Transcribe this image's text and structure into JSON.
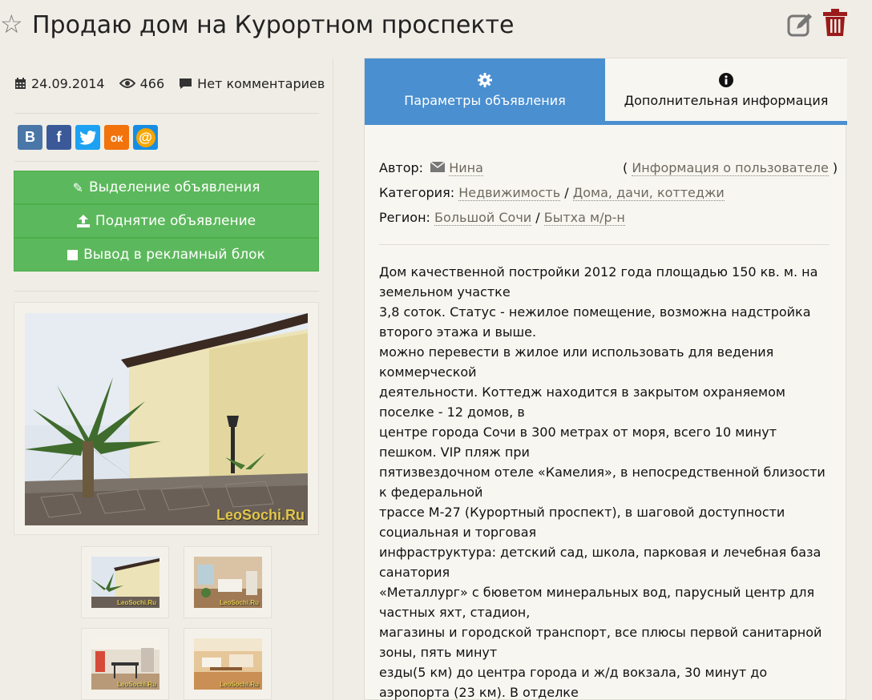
{
  "header": {
    "title": "Продаю дом на Курортном проспекте"
  },
  "meta": {
    "date": "24.09.2014",
    "views": "466",
    "comments": "Нет комментариев"
  },
  "social": [
    "В",
    "f",
    "t",
    "ок",
    "@"
  ],
  "promo": {
    "highlight": "Выделение объявления",
    "raise": "Поднятие объявление",
    "ad_block": "Вывод в рекламный блок"
  },
  "photos": {
    "watermark": "LeoSochi.Ru"
  },
  "tabs": {
    "params": "Параметры объявления",
    "extra": "Дополнительная информация"
  },
  "info": {
    "author_label": "Автор:",
    "author_name": "Нина",
    "user_info": "Информация о пользователе",
    "category_label": "Категория:",
    "category_1": "Недвижимость",
    "category_2": "Дома, дачи, коттеджи",
    "region_label": "Регион:",
    "region_1": "Большой Сочи",
    "region_2": "Бытха м/р-н"
  },
  "description": [
    "Дом качественной постройки 2012 года площадью 150 кв. м. на земельном участке",
    "3,8 соток. Статус - нежилое помещение, возможна надстройка второго этажа и выше.",
    "можно перевести в жилое или использовать для ведения коммерческой",
    "деятельности. Коттедж находится в закрытом охраняемом поселке - 12 домов, в",
    "центре города Сочи в 300 метрах от моря, всего 10 минут пешком. VIP пляж при",
    "пятизвездочном отеле «Камелия», в непосредственной близости к федеральной",
    "трассе М-27 (Курортный проспект), в шаговой доступности социальная и торговая",
    "инфраструктура: детский сад, школа, парковая и лечебная база санатория",
    "«Металлург» с бюветом минеральных вод, парусный центр для частных яхт, стадион,",
    "магазины и городской транспорт, все плюсы первой санитарной зоны, пять минут",
    "езды(5 км) до центра города и ж/д вокзала, 30 минут до аэропорта (23 км). В отделке"
  ],
  "colors": {
    "accent": "#4a8fd0",
    "promo_green": "#5cb85c",
    "trash_red": "#9b1b1b",
    "background": "#efede6"
  }
}
